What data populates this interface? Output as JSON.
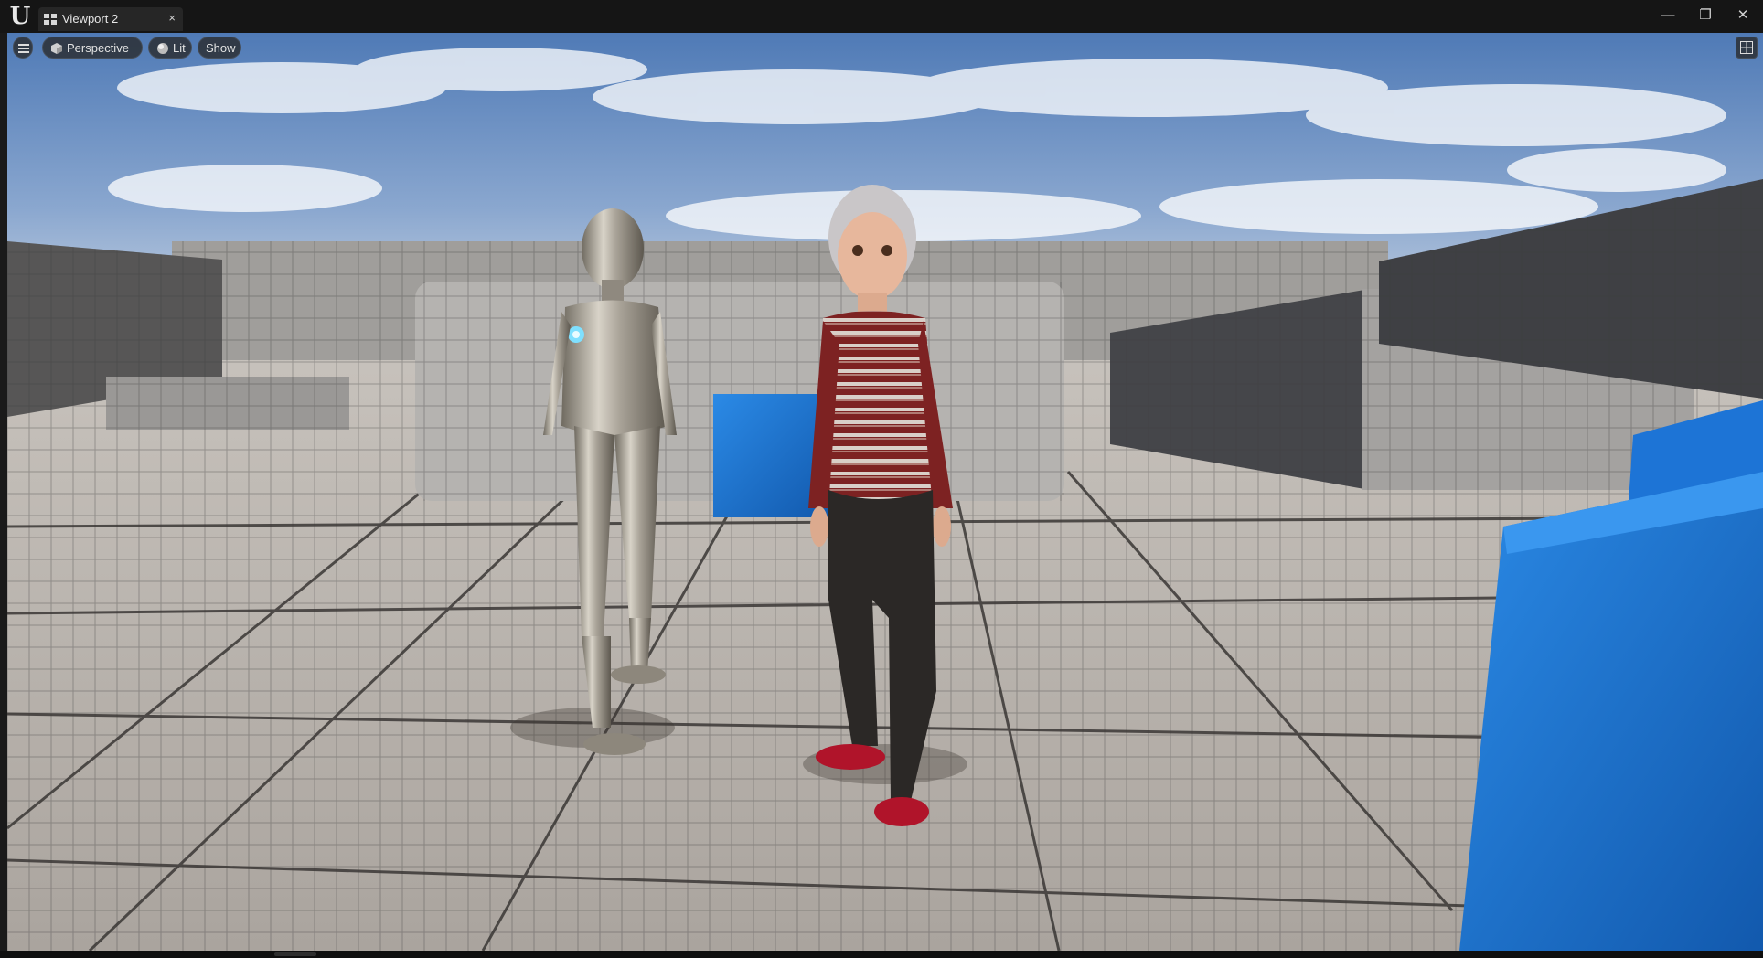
{
  "window": {
    "tab_label": "Viewport 2",
    "close_tab_glyph": "×",
    "minimize_glyph": "—",
    "restore_glyph": "❐",
    "close_glyph": "✕"
  },
  "toolbar": {
    "menu_icon": "hamburger-icon",
    "perspective_label": "Perspective",
    "lit_label": "Lit",
    "show_label": "Show",
    "layout_icon": "viewport-layout-icon"
  },
  "scene": {
    "description_objects": [
      "sky",
      "grid-floor",
      "grid-walls",
      "blue-cubes",
      "metallic-robot-mannequin",
      "elderly-woman-character"
    ],
    "colors": {
      "sky_top": "#5c86bf",
      "floor": "#b7b1ab",
      "wall": "#9d9b98",
      "dark_wall": "#4a4a4c",
      "cube_blue": "#1a73d0",
      "sweater": "#7d2222",
      "shoes": "#b0142a"
    }
  }
}
